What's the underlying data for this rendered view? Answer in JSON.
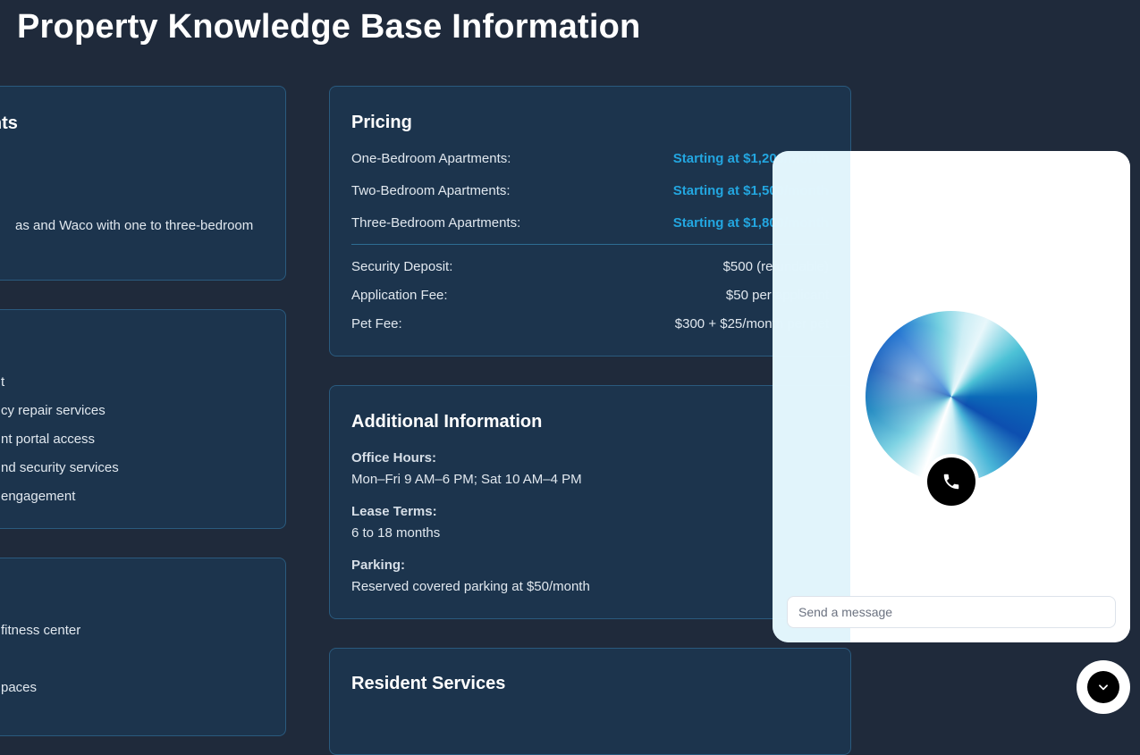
{
  "page": {
    "title": "Property Knowledge Base Information"
  },
  "left_column": {
    "card1": {
      "heading": "ments",
      "text": "as and Waco with one to three-bedroom"
    },
    "card2": {
      "items": [
        "t",
        "cy repair services",
        "nt portal access",
        "nd security services",
        "engagement"
      ]
    },
    "card3": {
      "items": [
        " fitness center",
        "paces"
      ]
    }
  },
  "pricing": {
    "heading": "Pricing",
    "apartments": [
      {
        "label": "One-Bedroom Apartments:",
        "value": "Starting at $1,200/month"
      },
      {
        "label": "Two-Bedroom Apartments:",
        "value": "Starting at $1,500/month"
      },
      {
        "label": "Three-Bedroom Apartments:",
        "value": "Starting at $1,800/month"
      }
    ],
    "fees": [
      {
        "label": "Security Deposit:",
        "value": "$500 (refundable)"
      },
      {
        "label": "Application Fee:",
        "value": "$50 per applicant"
      },
      {
        "label": "Pet Fee:",
        "value": "$300 + $25/month per pet"
      }
    ]
  },
  "additional_info": {
    "heading": "Additional Information",
    "items": [
      {
        "label": "Office Hours:",
        "value": "Mon–Fri 9 AM–6 PM; Sat 10 AM–4 PM"
      },
      {
        "label": "Lease Terms:",
        "value": "6 to 18 months"
      },
      {
        "label": "Parking:",
        "value": "Reserved covered parking at $50/month"
      }
    ]
  },
  "resident_services": {
    "heading": "Resident Services"
  },
  "chat": {
    "input_placeholder": "Send a message",
    "call_icon": "phone-icon",
    "toggle_icon": "chevron-down-icon"
  },
  "colors": {
    "background": "#1f2a3b",
    "card": "#1c344d",
    "accent": "#23a6e0"
  }
}
